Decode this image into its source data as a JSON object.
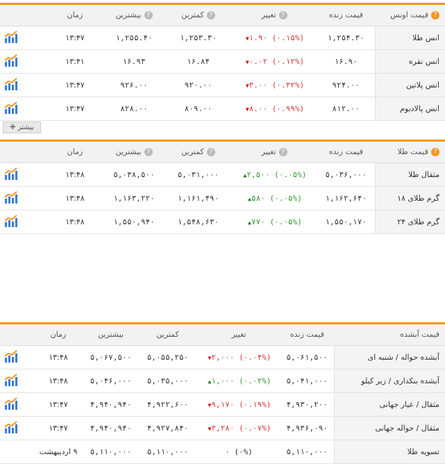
{
  "ounce": {
    "headers": {
      "name": "قیمت اونس",
      "live": "قیمت زنده",
      "change": "تغییر",
      "low": "کمترین",
      "high": "بیشترین",
      "time": "زمان"
    },
    "rows": [
      {
        "name": "انس طلا",
        "live": "۱,۲۵۴.۳۰",
        "change": "۱.۹۰",
        "pct": "(۰.۱۵%)",
        "dir": "down",
        "low": "۱,۲۵۳.۳۰",
        "high": "۱,۲۵۵.۴۰",
        "time": "۱۳:۴۷"
      },
      {
        "name": "انس نقره",
        "live": "۱۶.۹۰",
        "change": "۰.۰۲",
        "pct": "(۰.۱۲%)",
        "dir": "down",
        "low": "۱۶.۸۴",
        "high": "۱۶.۹۳",
        "time": "۱۳:۴۱"
      },
      {
        "name": "انس پلاتین",
        "live": "۹۲۴.۰۰",
        "change": "۳.۰۰",
        "pct": "(۰.۳۲%)",
        "dir": "down",
        "low": "۹۲۰.۰۰",
        "high": "۹۲۶.۰۰",
        "time": "۱۳:۴۷"
      },
      {
        "name": "انس پالادیوم",
        "live": "۸۱۲.۰۰",
        "change": "۸.۰۰",
        "pct": "(۰.۹۹%)",
        "dir": "down",
        "low": "۸۰۹.۰۰",
        "high": "۸۲۸.۰۰",
        "time": "۱۳:۴۷"
      }
    ],
    "more_label": "بیشتر"
  },
  "gold": {
    "headers": {
      "name": "قیمت طلا",
      "live": "قیمت زنده",
      "change": "تغییر",
      "low": "کمترین",
      "high": "بیشترین",
      "time": "زمان"
    },
    "rows": [
      {
        "name": "مثقال طلا",
        "live": "۵,۰۳۶,۰۰۰",
        "change": "۲,۵۰۰",
        "pct": "(۰.۰۵%)",
        "dir": "up",
        "low": "۵,۰۳۱,۰۰۰",
        "high": "۵,۰۳۸,۵۰۰",
        "time": "۱۳:۴۸"
      },
      {
        "name": "گرم طلای ۱۸",
        "live": "۱,۱۶۲,۶۴۰",
        "change": "۵۸۰",
        "pct": "(۰.۰۵%)",
        "dir": "up",
        "low": "۱,۱۶۱,۴۹۰",
        "high": "۱,۱۶۳,۲۲۰",
        "time": "۱۳:۴۸"
      },
      {
        "name": "گرم طلای ۲۴",
        "live": "۱,۵۵۰,۱۷۰",
        "change": "۷۷۰",
        "pct": "(۰.۰۵%)",
        "dir": "up",
        "low": "۱,۵۴۸,۶۳۰",
        "high": "۱,۵۵۰,۹۴۰",
        "time": "۱۳:۴۸"
      }
    ]
  },
  "bullion": {
    "headers": {
      "name": "قیمت آبشده",
      "live": "قیمت زنده",
      "change": "تغییر",
      "low": "کمترین",
      "high": "بیشترین",
      "time": "زمان"
    },
    "rows": [
      {
        "name": "آبشده حواله / شنبه ای",
        "live": "۵,۰۶۱,۵۰۰",
        "change": "۲,۰۰۰",
        "pct": "(۰.۰۴%)",
        "dir": "down",
        "low": "۵,۰۵۵,۲۵۰",
        "high": "۵,۰۶۷,۵۰۰",
        "time": "۱۳:۴۸",
        "chart": true
      },
      {
        "name": "آبشده بنکداری / زیر کیلو",
        "live": "۵,۰۴۱,۰۰۰",
        "change": "۱,۰۰۰",
        "pct": "(۰.۰۲%)",
        "dir": "up",
        "low": "۵,۰۳۵,۰۰۰",
        "high": "۵,۰۴۶,۰۰۰",
        "time": "۱۳:۴۸",
        "chart": true
      },
      {
        "name": "مثقال / عیار جهانی",
        "live": "۴,۹۳۰,۲۰۰",
        "change": "۹,۱۷۰",
        "pct": "(۰.۱۹%)",
        "dir": "down",
        "low": "۴,۹۲۲,۶۰۰",
        "high": "۴,۹۴۰,۹۴۰",
        "time": "۱۳:۴۷",
        "chart": true
      },
      {
        "name": "مثقال / حواله جهانی",
        "live": "۴,۹۳۶,۰۹۰",
        "change": "۳,۲۸۰",
        "pct": "(۰.۰۷%)",
        "dir": "down",
        "low": "۴,۹۲۷,۸۴۰",
        "high": "۴,۹۴۰,۹۴۰",
        "time": "۱۳:۴۷",
        "chart": true
      },
      {
        "name": "تسویه طلا",
        "live": "۵,۱۱۰,۰۰۰",
        "change": "۰",
        "pct": "(۰%)",
        "dir": "none",
        "low": "۵,۱۱۰,۰۰۰",
        "high": "۵,۱۱۰,۰۰۰",
        "time": "۹ اردیبهشت",
        "chart": false
      }
    ]
  },
  "colors": {
    "accent": "#f7941d",
    "down": "#d33333",
    "up": "#2a9a2a"
  },
  "icons": {
    "chart": "line-chart-icon",
    "help": "question-icon",
    "more": "plus-icon"
  }
}
